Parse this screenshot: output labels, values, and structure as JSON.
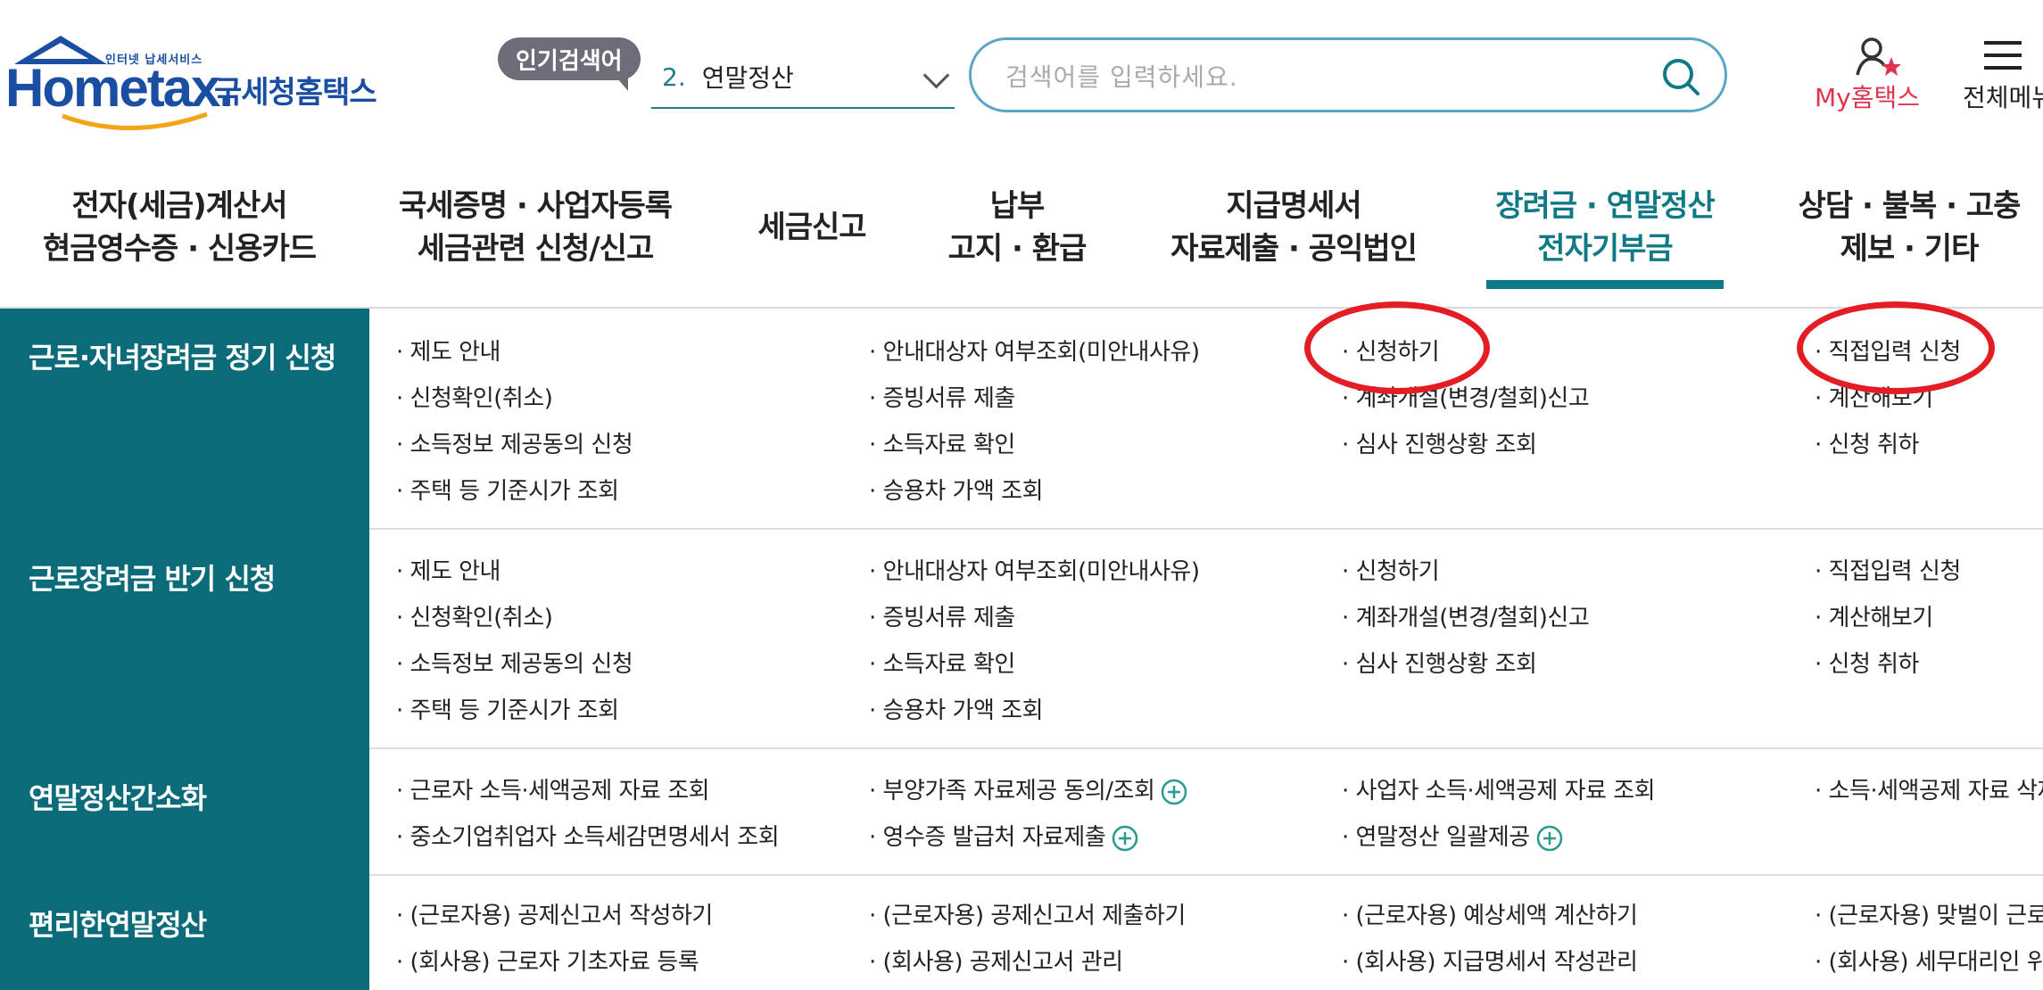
{
  "header": {
    "logo_small": "인터넷 납세서비스",
    "logo_main": "Hometax.",
    "logo_kr": "국세청홈택스",
    "popular_badge": "인기검색어",
    "popular_rank": "2.",
    "popular_term": "연말정산",
    "search_placeholder": "검색어를 입력하세요.",
    "search_value": "",
    "my_hometax": "My홈택스",
    "all_menu": "전체메뉴"
  },
  "tabs": [
    {
      "line1": "전자(세금)계산서",
      "line2": "현금영수증 · 신용카드"
    },
    {
      "line1": "국세증명 · 사업자등록",
      "line2": "세금관련 신청/신고"
    },
    {
      "line1": "세금신고",
      "line2": ""
    },
    {
      "line1": "납부",
      "line2": "고지 · 환급"
    },
    {
      "line1": "지급명세서",
      "line2": "자료제출 · 공익법인"
    },
    {
      "line1": "장려금 · 연말정산",
      "line2": "전자기부금"
    },
    {
      "line1": "상담 · 불복 · 고충",
      "line2": "제보 · 기타"
    }
  ],
  "active_tab_index": 5,
  "sections": [
    {
      "title": "근로·자녀장려금 정기 신청",
      "cols": [
        [
          "· 제도 안내",
          "· 신청확인(취소)",
          "· 소득정보 제공동의 신청",
          "· 주택 등 기준시가 조회"
        ],
        [
          "· 안내대상자 여부조회(미안내사유)",
          "· 증빙서류 제출",
          "· 소득자료 확인",
          "· 승용차 가액 조회"
        ],
        [
          "· 신청하기",
          "· 계좌개설(변경/철회)신고",
          "· 심사 진행상황 조회"
        ],
        [
          "· 직접입력 신청",
          "· 계산해보기",
          "· 신청 취하"
        ]
      ]
    },
    {
      "title": "근로장려금 반기 신청",
      "cols": [
        [
          "· 제도 안내",
          "· 신청확인(취소)",
          "· 소득정보 제공동의 신청",
          "· 주택 등 기준시가 조회"
        ],
        [
          "· 안내대상자 여부조회(미안내사유)",
          "· 증빙서류 제출",
          "· 소득자료 확인",
          "· 승용차 가액 조회"
        ],
        [
          "· 신청하기",
          "· 계좌개설(변경/철회)신고",
          "· 심사 진행상황 조회"
        ],
        [
          "· 직접입력 신청",
          "· 계산해보기",
          "· 신청 취하"
        ]
      ]
    },
    {
      "title": "연말정산간소화",
      "cols": [
        [
          "· 근로자 소득·세액공제 자료 조회",
          "· 중소기업취업자 소득세감면명세서 조회"
        ],
        [
          "· 부양가족 자료제공 동의/조회",
          "· 영수증 발급처 자료제출"
        ],
        [
          "· 사업자 소득·세액공제 자료 조회",
          "· 연말정산 일괄제공"
        ],
        [
          "· 소득·세액공제 자료 삭제"
        ]
      ]
    },
    {
      "title": "편리한연말정산",
      "cols": [
        [
          "· (근로자용) 공제신고서 작성하기",
          "· (회사용) 근로자 기초자료 등록"
        ],
        [
          "· (근로자용) 공제신고서 제출하기",
          "· (회사용) 공제신고서 관리"
        ],
        [
          "· (근로자용) 예상세액 계산하기",
          "· (회사용) 지급명세서 작성관리"
        ],
        [
          "· (근로자용) 맞벌이 근로자",
          "· (회사용) 세무대리인 위임"
        ]
      ]
    }
  ],
  "colors": {
    "teal": "#0c6b78",
    "accent": "#0f7a85",
    "brand_blue": "#1a4ea3",
    "my_red": "#e0334f",
    "highlight_circle": "#e41c23"
  }
}
